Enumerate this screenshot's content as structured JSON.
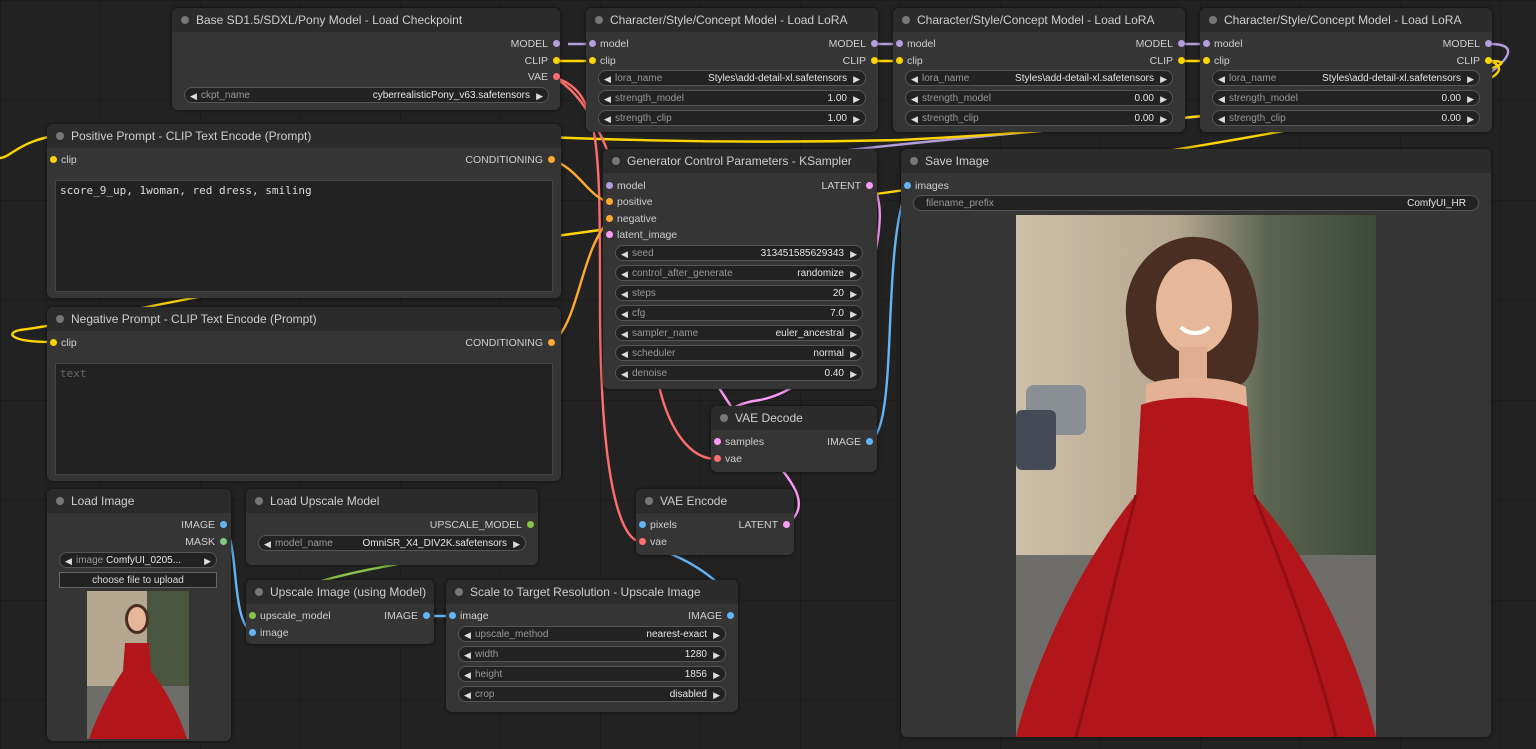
{
  "colors": {
    "model": "#b39ddb",
    "clip": "#ffd500",
    "vae": "#ff6e6e",
    "conditioning": "#ffa931",
    "latent": "#ff9cf9",
    "image": "#64b5f6",
    "upscale_model": "#8bc34a"
  },
  "checkpoint": {
    "title": "Base SD1.5/SDXL/Pony Model - Load Checkpoint",
    "out_model": "MODEL",
    "out_clip": "CLIP",
    "out_vae": "VAE",
    "ckpt_name_label": "ckpt_name",
    "ckpt_name_value": "cyberrealisticPony_v63.safetensors"
  },
  "lora1": {
    "title": "Character/Style/Concept Model - Load LoRA",
    "in_model": "model",
    "in_clip": "clip",
    "out_model": "MODEL",
    "out_clip": "CLIP",
    "lora_name_label": "lora_name",
    "lora_name_value": "Styles\\add-detail-xl.safetensors",
    "strength_model_label": "strength_model",
    "strength_model_value": "1.00",
    "strength_clip_label": "strength_clip",
    "strength_clip_value": "1.00"
  },
  "lora2": {
    "title": "Character/Style/Concept Model - Load LoRA",
    "in_model": "model",
    "in_clip": "clip",
    "out_model": "MODEL",
    "out_clip": "CLIP",
    "lora_name_label": "lora_name",
    "lora_name_value": "Styles\\add-detail-xl.safetensors",
    "strength_model_label": "strength_model",
    "strength_model_value": "0.00",
    "strength_clip_label": "strength_clip",
    "strength_clip_value": "0.00"
  },
  "lora3": {
    "title": "Character/Style/Concept Model - Load LoRA",
    "in_model": "model",
    "in_clip": "clip",
    "out_model": "MODEL",
    "out_clip": "CLIP",
    "lora_name_label": "lora_name",
    "lora_name_value": "Styles\\add-detail-xl.safetensors",
    "strength_model_label": "strength_model",
    "strength_model_value": "0.00",
    "strength_clip_label": "strength_clip",
    "strength_clip_value": "0.00"
  },
  "positive": {
    "title": "Positive Prompt - CLIP Text Encode (Prompt)",
    "in_clip": "clip",
    "out": "CONDITIONING",
    "text": "score_9_up, 1woman, red dress, smiling"
  },
  "negative": {
    "title": "Negative Prompt - CLIP Text Encode (Prompt)",
    "in_clip": "clip",
    "out": "CONDITIONING",
    "placeholder": "text"
  },
  "ksampler": {
    "title": "Generator Control Parameters - KSampler",
    "in_model": "model",
    "in_positive": "positive",
    "in_negative": "negative",
    "in_latent": "latent_image",
    "out_latent": "LATENT",
    "widgets": [
      {
        "label": "seed",
        "value": "313451585629343"
      },
      {
        "label": "control_after_generate",
        "value": "randomize"
      },
      {
        "label": "steps",
        "value": "20"
      },
      {
        "label": "cfg",
        "value": "7.0"
      },
      {
        "label": "sampler_name",
        "value": "euler_ancestral"
      },
      {
        "label": "scheduler",
        "value": "normal"
      },
      {
        "label": "denoise",
        "value": "0.40"
      }
    ]
  },
  "save": {
    "title": "Save Image",
    "in_images": "images",
    "filename_prefix_label": "filename_prefix",
    "filename_prefix_value": "ComfyUI_HR"
  },
  "vae_decode": {
    "title": "VAE Decode",
    "in_samples": "samples",
    "in_vae": "vae",
    "out_image": "IMAGE"
  },
  "vae_encode": {
    "title": "VAE Encode",
    "in_pixels": "pixels",
    "in_vae": "vae",
    "out_latent": "LATENT"
  },
  "load_image": {
    "title": "Load Image",
    "out_image": "IMAGE",
    "out_mask": "MASK",
    "image_label": "image",
    "image_value": "ComfyUI_0205...",
    "upload_label": "choose file to upload"
  },
  "load_upscale": {
    "title": "Load Upscale Model",
    "out": "UPSCALE_MODEL",
    "model_name_label": "model_name",
    "model_name_value": "OmniSR_X4_DIV2K.safetensors"
  },
  "upscale_image": {
    "title": "Upscale Image (using Model)",
    "in_upscale_model": "upscale_model",
    "in_image": "image",
    "out_image": "IMAGE"
  },
  "scale_target": {
    "title": "Scale to Target Resolution - Upscale Image",
    "in_image": "image",
    "out_image": "IMAGE",
    "widgets": [
      {
        "label": "upscale_method",
        "value": "nearest-exact"
      },
      {
        "label": "width",
        "value": "1280"
      },
      {
        "label": "height",
        "value": "1856"
      },
      {
        "label": "crop",
        "value": "disabled"
      }
    ]
  }
}
